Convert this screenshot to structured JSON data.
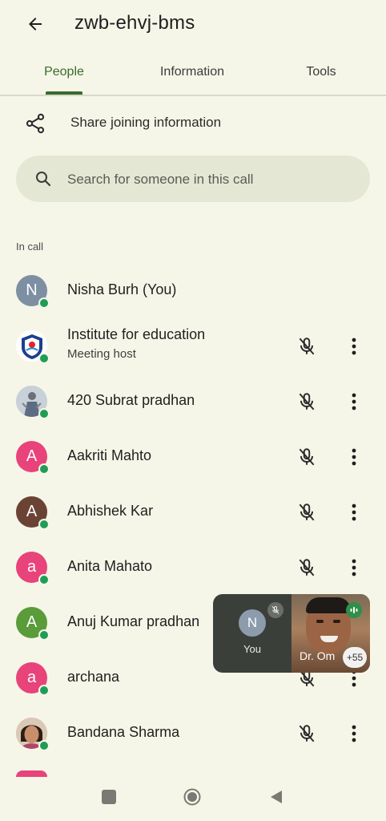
{
  "header": {
    "title": "zwb-ehvj-bms",
    "back_icon": "arrow-left-icon"
  },
  "tabs": [
    {
      "label": "People",
      "active": true
    },
    {
      "label": "Information",
      "active": false
    },
    {
      "label": "Tools",
      "active": false
    }
  ],
  "share": {
    "label": "Share joining information",
    "icon": "share-icon"
  },
  "search": {
    "placeholder": "Search for someone in this call",
    "icon": "search-icon"
  },
  "section_label": "In call",
  "participants": [
    {
      "initial": "N",
      "name": "Nisha Burh (You)",
      "subtitle": "",
      "avatar_color": "#7d8fa3",
      "online": true,
      "muted_icon": false,
      "more_icon": false
    },
    {
      "initial": "",
      "name": "Institute for education",
      "subtitle": "Meeting host",
      "avatar_color": "#ffffff",
      "avatar_type": "logo",
      "online": true,
      "muted_icon": true,
      "more_icon": true
    },
    {
      "initial": "",
      "name": "420 Subrat pradhan",
      "subtitle": "",
      "avatar_color": "#cfd6de",
      "avatar_type": "photo",
      "online": true,
      "muted_icon": true,
      "more_icon": true
    },
    {
      "initial": "A",
      "name": "Aakriti Mahto",
      "subtitle": "",
      "avatar_color": "#e8437a",
      "online": true,
      "muted_icon": true,
      "more_icon": true
    },
    {
      "initial": "A",
      "name": "Abhishek Kar",
      "subtitle": "",
      "avatar_color": "#6b4335",
      "online": true,
      "muted_icon": true,
      "more_icon": true
    },
    {
      "initial": "a",
      "name": "Anita Mahato",
      "subtitle": "",
      "avatar_color": "#e8437a",
      "online": true,
      "muted_icon": true,
      "more_icon": true
    },
    {
      "initial": "A",
      "name": "Anuj Kumar pradhan",
      "subtitle": "",
      "avatar_color": "#5a9b3a",
      "online": true,
      "muted_icon": false,
      "more_icon": false
    },
    {
      "initial": "a",
      "name": "archana",
      "subtitle": "",
      "avatar_color": "#e8437a",
      "online": true,
      "muted_icon": true,
      "more_icon": true
    },
    {
      "initial": "",
      "name": "Bandana Sharma",
      "subtitle": "",
      "avatar_color": "#c9a98a",
      "avatar_type": "photo",
      "online": true,
      "muted_icon": true,
      "more_icon": true
    }
  ],
  "pip": {
    "self_initial": "N",
    "self_label": "You",
    "speaker_name": "Dr. Om",
    "more_count": "+55"
  },
  "colors": {
    "accent": "#3a6b2c",
    "online": "#1f9d55",
    "background": "#f6f6e8"
  }
}
